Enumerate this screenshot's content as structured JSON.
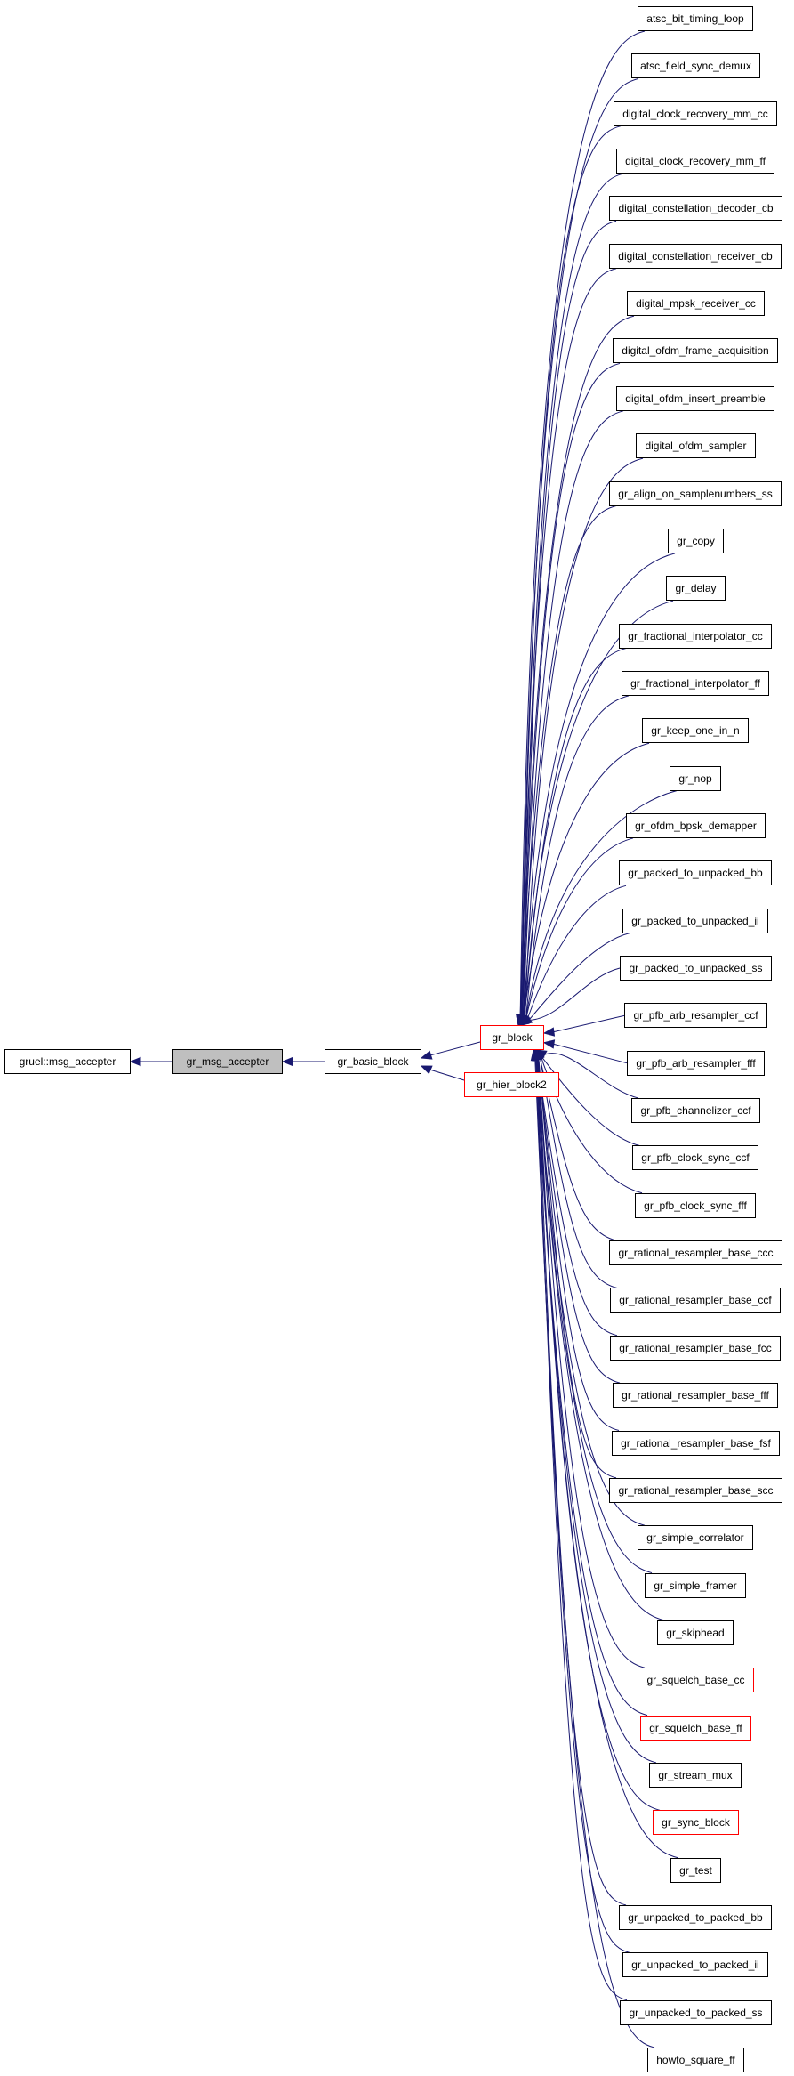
{
  "diagram": {
    "type": "inheritance-graph",
    "edge_color": "#191970",
    "highlight_fill": "#bfbfbf",
    "incomplete_border": "#ff0000",
    "chain": [
      {
        "id": "gruel",
        "label": "gruel::msg_accepter",
        "style": "normal"
      },
      {
        "id": "msg",
        "label": "gr_msg_accepter",
        "style": "current"
      },
      {
        "id": "basic",
        "label": "gr_basic_block",
        "style": "normal"
      }
    ],
    "mid": [
      {
        "id": "block",
        "label": "gr_block",
        "style": "truncated"
      },
      {
        "id": "hier",
        "label": "gr_hier_block2",
        "style": "truncated"
      }
    ],
    "children": [
      {
        "label": "atsc_bit_timing_loop",
        "style": "normal"
      },
      {
        "label": "atsc_field_sync_demux",
        "style": "normal"
      },
      {
        "label": "digital_clock_recovery_mm_cc",
        "style": "normal"
      },
      {
        "label": "digital_clock_recovery_mm_ff",
        "style": "normal"
      },
      {
        "label": "digital_constellation_decoder_cb",
        "style": "normal"
      },
      {
        "label": "digital_constellation_receiver_cb",
        "style": "normal"
      },
      {
        "label": "digital_mpsk_receiver_cc",
        "style": "normal"
      },
      {
        "label": "digital_ofdm_frame_acquisition",
        "style": "normal"
      },
      {
        "label": "digital_ofdm_insert_preamble",
        "style": "normal"
      },
      {
        "label": "digital_ofdm_sampler",
        "style": "normal"
      },
      {
        "label": "gr_align_on_samplenumbers_ss",
        "style": "normal"
      },
      {
        "label": "gr_copy",
        "style": "normal"
      },
      {
        "label": "gr_delay",
        "style": "normal"
      },
      {
        "label": "gr_fractional_interpolator_cc",
        "style": "normal"
      },
      {
        "label": "gr_fractional_interpolator_ff",
        "style": "normal"
      },
      {
        "label": "gr_keep_one_in_n",
        "style": "normal"
      },
      {
        "label": "gr_nop",
        "style": "normal"
      },
      {
        "label": "gr_ofdm_bpsk_demapper",
        "style": "normal"
      },
      {
        "label": "gr_packed_to_unpacked_bb",
        "style": "normal"
      },
      {
        "label": "gr_packed_to_unpacked_ii",
        "style": "normal"
      },
      {
        "label": "gr_packed_to_unpacked_ss",
        "style": "normal"
      },
      {
        "label": "gr_pfb_arb_resampler_ccf",
        "style": "normal"
      },
      {
        "label": "gr_pfb_arb_resampler_fff",
        "style": "normal"
      },
      {
        "label": "gr_pfb_channelizer_ccf",
        "style": "normal"
      },
      {
        "label": "gr_pfb_clock_sync_ccf",
        "style": "normal"
      },
      {
        "label": "gr_pfb_clock_sync_fff",
        "style": "normal"
      },
      {
        "label": "gr_rational_resampler_base_ccc",
        "style": "normal"
      },
      {
        "label": "gr_rational_resampler_base_ccf",
        "style": "normal"
      },
      {
        "label": "gr_rational_resampler_base_fcc",
        "style": "normal"
      },
      {
        "label": "gr_rational_resampler_base_fff",
        "style": "normal"
      },
      {
        "label": "gr_rational_resampler_base_fsf",
        "style": "normal"
      },
      {
        "label": "gr_rational_resampler_base_scc",
        "style": "normal"
      },
      {
        "label": "gr_simple_correlator",
        "style": "normal"
      },
      {
        "label": "gr_simple_framer",
        "style": "normal"
      },
      {
        "label": "gr_skiphead",
        "style": "normal"
      },
      {
        "label": "gr_squelch_base_cc",
        "style": "truncated"
      },
      {
        "label": "gr_squelch_base_ff",
        "style": "truncated"
      },
      {
        "label": "gr_stream_mux",
        "style": "normal"
      },
      {
        "label": "gr_sync_block",
        "style": "truncated"
      },
      {
        "label": "gr_test",
        "style": "normal"
      },
      {
        "label": "gr_unpacked_to_packed_bb",
        "style": "normal"
      },
      {
        "label": "gr_unpacked_to_packed_ii",
        "style": "normal"
      },
      {
        "label": "gr_unpacked_to_packed_ss",
        "style": "normal"
      },
      {
        "label": "howto_square_ff",
        "style": "normal"
      }
    ]
  }
}
